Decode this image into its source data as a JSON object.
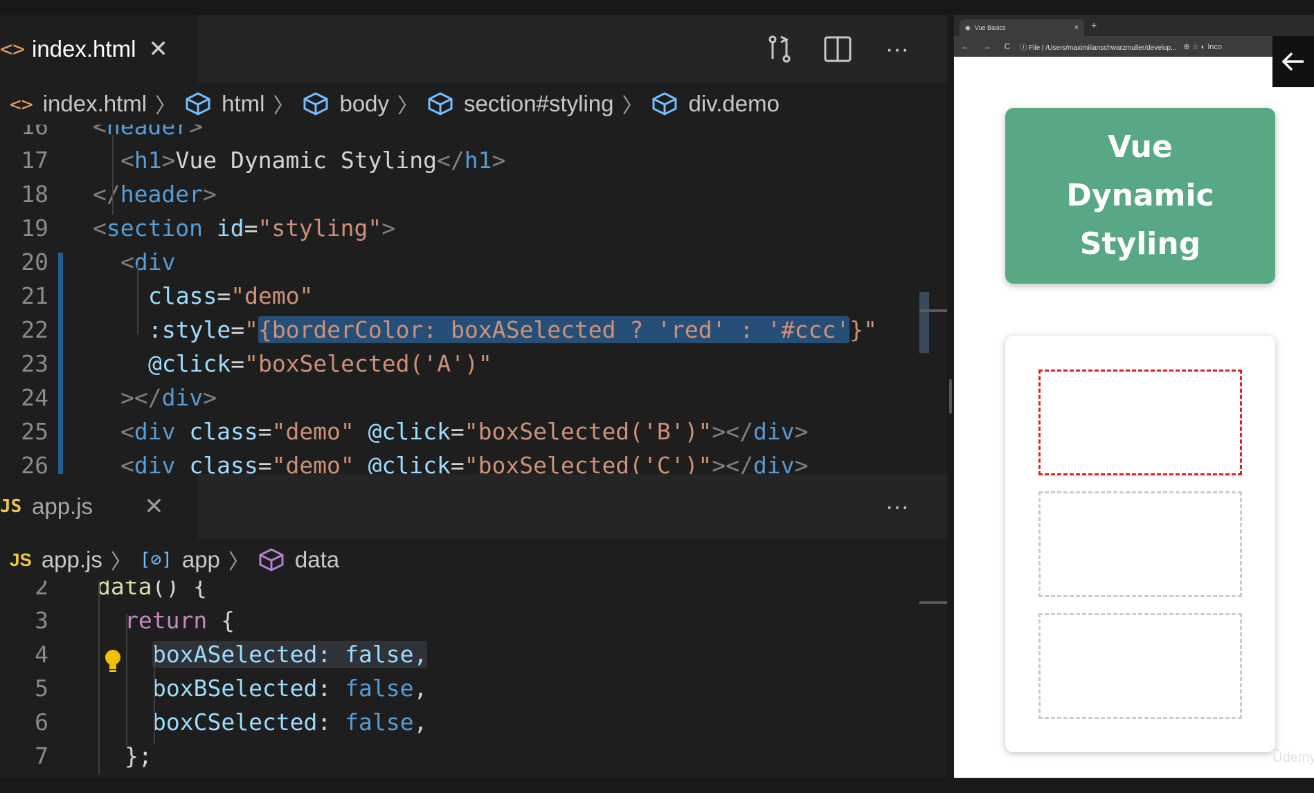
{
  "editor1": {
    "tab": {
      "icon": "<>",
      "label": "index.html",
      "close": "✕"
    },
    "breadcrumb": [
      "index.html",
      "html",
      "body",
      "section#styling",
      "div.demo"
    ],
    "lines": [
      {
        "n": "16",
        "indent": 1,
        "segs": [
          [
            "punct",
            "<"
          ],
          [
            "tag",
            "header"
          ],
          [
            "punct",
            ">"
          ]
        ]
      },
      {
        "n": "17",
        "indent": 2,
        "segs": [
          [
            "punct",
            "<"
          ],
          [
            "tag",
            "h1"
          ],
          [
            "punct",
            ">"
          ],
          [
            "txt-w",
            "Vue Dynamic Styling"
          ],
          [
            "punct",
            "</"
          ],
          [
            "tag",
            "h1"
          ],
          [
            "punct",
            ">"
          ]
        ]
      },
      {
        "n": "18",
        "indent": 1,
        "segs": [
          [
            "punct",
            "</"
          ],
          [
            "tag",
            "header"
          ],
          [
            "punct",
            ">"
          ]
        ]
      },
      {
        "n": "19",
        "indent": 1,
        "segs": [
          [
            "punct",
            "<"
          ],
          [
            "tag",
            "section"
          ],
          [
            "txt-w",
            " "
          ],
          [
            "attr",
            "id"
          ],
          [
            "txt-w",
            "="
          ],
          [
            "str",
            "\"styling\""
          ],
          [
            "punct",
            ">"
          ]
        ]
      },
      {
        "n": "20",
        "indent": 2,
        "segs": [
          [
            "punct",
            "<"
          ],
          [
            "tag",
            "div"
          ]
        ]
      },
      {
        "n": "21",
        "indent": 3,
        "segs": [
          [
            "attr",
            "class"
          ],
          [
            "txt-w",
            "="
          ],
          [
            "str",
            "\"demo\""
          ]
        ]
      },
      {
        "n": "22",
        "indent": 3,
        "segs": [
          [
            "attr",
            ":style"
          ],
          [
            "txt-w",
            "="
          ],
          [
            "str",
            "\""
          ],
          [
            "sel",
            "{borderColor: boxASelected ? 'red' : '#ccc'"
          ],
          [
            "str",
            "}\""
          ]
        ]
      },
      {
        "n": "23",
        "indent": 3,
        "segs": [
          [
            "attr",
            "@click"
          ],
          [
            "txt-w",
            "="
          ],
          [
            "str",
            "\"boxSelected('A')\""
          ]
        ]
      },
      {
        "n": "24",
        "indent": 2,
        "segs": [
          [
            "punct",
            "></"
          ],
          [
            "tag",
            "div"
          ],
          [
            "punct",
            ">"
          ]
        ]
      },
      {
        "n": "25",
        "indent": 2,
        "segs": [
          [
            "punct",
            "<"
          ],
          [
            "tag",
            "div"
          ],
          [
            "txt-w",
            " "
          ],
          [
            "attr",
            "class"
          ],
          [
            "txt-w",
            "="
          ],
          [
            "str",
            "\"demo\""
          ],
          [
            "txt-w",
            " "
          ],
          [
            "attr",
            "@click"
          ],
          [
            "txt-w",
            "="
          ],
          [
            "str",
            "\"boxSelected('B')\""
          ],
          [
            "punct",
            "></"
          ],
          [
            "tag",
            "div"
          ],
          [
            "punct",
            ">"
          ]
        ]
      },
      {
        "n": "26",
        "indent": 2,
        "segs": [
          [
            "punct",
            "<"
          ],
          [
            "tag",
            "div"
          ],
          [
            "txt-w",
            " "
          ],
          [
            "attr",
            "class"
          ],
          [
            "txt-w",
            "="
          ],
          [
            "str",
            "\"demo\""
          ],
          [
            "txt-w",
            " "
          ],
          [
            "attr",
            "@click"
          ],
          [
            "txt-w",
            "="
          ],
          [
            "str",
            "\"boxSelected('C')\""
          ],
          [
            "punct",
            "></"
          ],
          [
            "tag",
            "div"
          ],
          [
            "punct",
            ">"
          ]
        ]
      }
    ]
  },
  "editor2": {
    "tab": {
      "icon": "JS",
      "label": "app.js",
      "close": "✕"
    },
    "breadcrumb": [
      "app.js",
      "app",
      "data"
    ],
    "lines": [
      {
        "n": "2",
        "indent": 1,
        "segs": [
          [
            "fn",
            "data"
          ],
          [
            "txt-w",
            "() {"
          ]
        ]
      },
      {
        "n": "3",
        "indent": 2,
        "segs": [
          [
            "ctrl",
            "return"
          ],
          [
            "txt-w",
            " {"
          ]
        ]
      },
      {
        "n": "4",
        "indent": 3,
        "segs": [
          [
            "sel2",
            "boxASelected: false,"
          ]
        ]
      },
      {
        "n": "5",
        "indent": 3,
        "segs": [
          [
            "prop",
            "boxBSelected"
          ],
          [
            "txt-w",
            ": "
          ],
          [
            "kw",
            "false"
          ],
          [
            "txt-w",
            ","
          ]
        ]
      },
      {
        "n": "6",
        "indent": 3,
        "segs": [
          [
            "prop",
            "boxCSelected"
          ],
          [
            "txt-w",
            ": "
          ],
          [
            "kw",
            "false"
          ],
          [
            "txt-w",
            ","
          ]
        ]
      },
      {
        "n": "7",
        "indent": 2,
        "segs": [
          [
            "txt-w",
            "};"
          ]
        ]
      }
    ]
  },
  "actions": {
    "compare": "compare-changes-icon",
    "split": "split-editor-icon",
    "more": "···"
  },
  "browser": {
    "tab_title": "Vue Basics",
    "tab_close": "×",
    "new_tab": "+",
    "nav": "← → C",
    "url": "ⓘ File | /Users/maximilianschwarzmuller/develop...",
    "right_icons": "⊕ ☆ ◐ Inco",
    "heading": "Vue Dynamic Styling",
    "watermark": "Ûdemy"
  },
  "colors": {
    "header_green": "#58a883",
    "selected_border": "#e02020",
    "default_border": "#cccccc"
  },
  "boxes": [
    {
      "id": "A",
      "selected": true
    },
    {
      "id": "B",
      "selected": false
    },
    {
      "id": "C",
      "selected": false
    }
  ]
}
